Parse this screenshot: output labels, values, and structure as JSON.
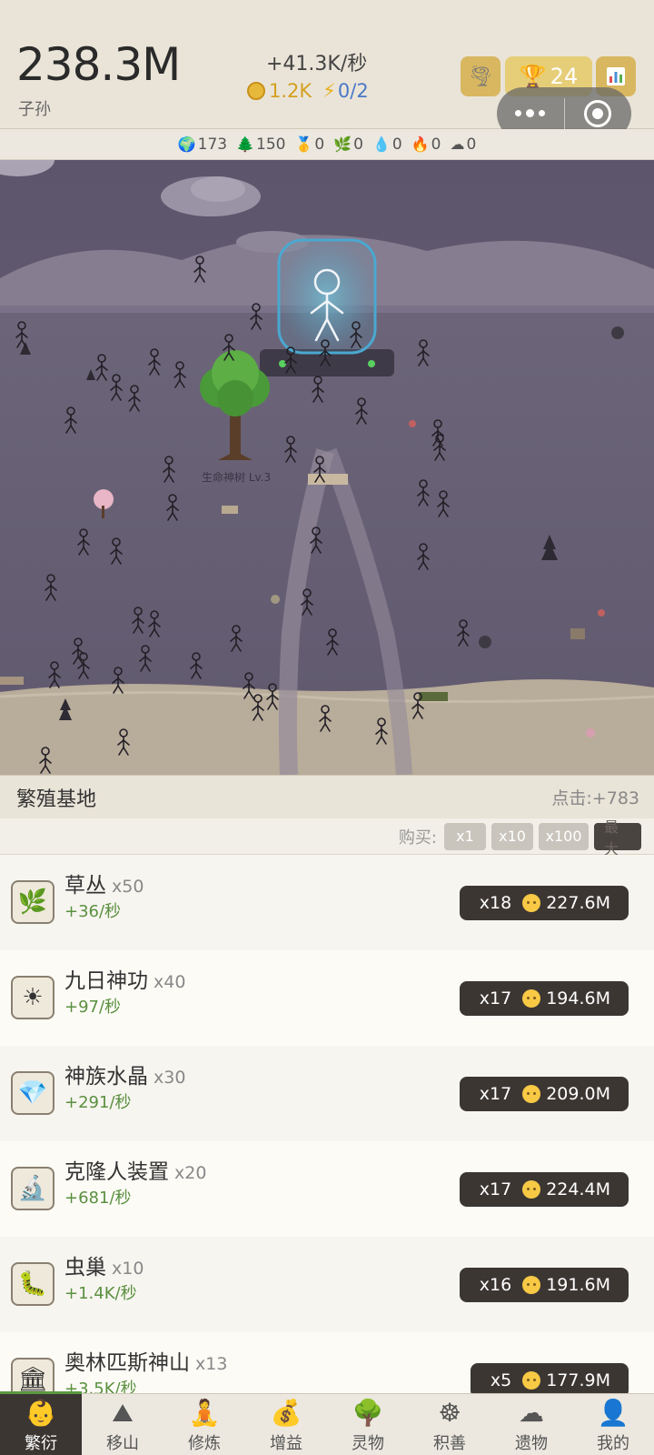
{
  "header": {
    "population_value": "238.3M",
    "population_label": "子孙",
    "rate": "+41.3K/秒",
    "coins": "1.2K",
    "energy": "0/2",
    "trophy_count": "24"
  },
  "resources": [
    {
      "icon": "globe-icon",
      "glyph": "🌍",
      "value": "173"
    },
    {
      "icon": "tree-icon",
      "glyph": "🌲",
      "value": "150"
    },
    {
      "icon": "medal-icon",
      "glyph": "🥇",
      "value": "0"
    },
    {
      "icon": "herb-icon",
      "glyph": "🌿",
      "value": "0"
    },
    {
      "icon": "water-drop-icon",
      "glyph": "💧",
      "value": "0"
    },
    {
      "icon": "fire-icon",
      "glyph": "🔥",
      "value": "0"
    },
    {
      "icon": "cloud-icon",
      "glyph": "☁",
      "value": "0"
    }
  ],
  "scene": {
    "tree_label": "生命神树 Lv.3"
  },
  "base": {
    "title": "繁殖基地",
    "click_value": "点击:+783",
    "buy_label": "购买:",
    "buy_options": [
      "x1",
      "x10",
      "x100",
      "最大"
    ]
  },
  "upgrades": [
    {
      "icon": "herb-icon",
      "glyph": "🌿",
      "name": "草丛",
      "count": "x50",
      "rate": "+36/秒",
      "mult": "x18",
      "cost": "227.6M"
    },
    {
      "icon": "sun-icon",
      "glyph": "☀",
      "name": "九日神功",
      "count": "x40",
      "rate": "+97/秒",
      "mult": "x17",
      "cost": "194.6M"
    },
    {
      "icon": "crystal-icon",
      "glyph": "💎",
      "name": "神族水晶",
      "count": "x30",
      "rate": "+291/秒",
      "mult": "x17",
      "cost": "209.0M"
    },
    {
      "icon": "microscope-icon",
      "glyph": "🔬",
      "name": "克隆人装置",
      "count": "x20",
      "rate": "+681/秒",
      "mult": "x17",
      "cost": "224.4M"
    },
    {
      "icon": "worm-icon",
      "glyph": "🐛",
      "name": "虫巢",
      "count": "x10",
      "rate": "+1.4K/秒",
      "mult": "x16",
      "cost": "191.6M"
    },
    {
      "icon": "temple-icon",
      "glyph": "🏛",
      "name": "奥林匹斯神山",
      "count": "x13",
      "rate": "+3.5K/秒",
      "mult": "x5",
      "cost": "177.9M"
    }
  ],
  "nav": [
    {
      "icon": "baby-icon",
      "glyph": "👶",
      "label": "繁衍"
    },
    {
      "icon": "mountain-icon",
      "glyph": "⛰",
      "label": "移山"
    },
    {
      "icon": "meditation-icon",
      "glyph": "🧘",
      "label": "修炼"
    },
    {
      "icon": "money-bag-icon",
      "glyph": "💰",
      "label": "增益"
    },
    {
      "icon": "tree-icon",
      "glyph": "🌳",
      "label": "灵物"
    },
    {
      "icon": "dharma-wheel-icon",
      "glyph": "☸",
      "label": "积善"
    },
    {
      "icon": "cloud-icon",
      "glyph": "☁",
      "label": "遗物"
    },
    {
      "icon": "user-icon",
      "glyph": "👤",
      "label": "我的"
    }
  ]
}
